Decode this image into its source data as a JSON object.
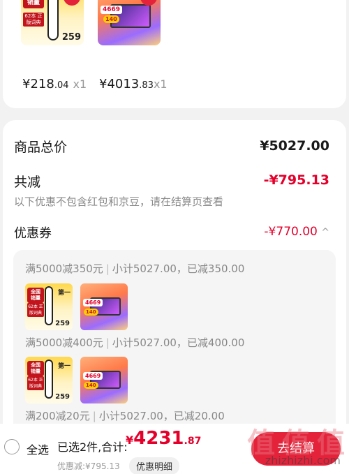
{
  "top_products": [
    {
      "name": "translation-pen",
      "price_int": "¥218",
      "price_dec": ".04",
      "qty": "x1",
      "badge_lines": [
        "全国",
        "销量"
      ],
      "badge2": "62本 正版词典",
      "promo": "第一",
      "tag_price": "259"
    },
    {
      "name": "laptop",
      "price_int": "¥4013",
      "price_dec": ".83",
      "qty": "x1",
      "badge_price": "4669",
      "badge_sub": "140"
    }
  ],
  "summary": {
    "goods_total_label": "商品总价",
    "goods_total_value": "¥5027.00",
    "total_reduce_label": "共减",
    "total_reduce_value": "-¥795.13",
    "reduce_note": "以下优惠不包含红包和京豆，请在结算页查看",
    "coupon_label": "优惠券",
    "coupon_value": "-¥770.00",
    "coupon_chevron": "^"
  },
  "coupon_rules": [
    {
      "rule": "满5000减350元",
      "detail": "小计5027.00，已减350.00"
    },
    {
      "rule": "满5000减400元",
      "detail": "小计5027.00，已减400.00"
    },
    {
      "rule": "满200减20元",
      "detail": "小计5027.00，已减20.00"
    }
  ],
  "bottom_bar": {
    "select_all": "全选",
    "selected_prefix": "已选2件,合计:",
    "total_yen": "¥",
    "total_int": "4231",
    "total_dec": ".87",
    "discount": "优惠减:¥795.13",
    "detail_button": "优惠明细",
    "checkout_button": "去结算"
  },
  "watermark": {
    "logo": "值 值 值",
    "url": "zhizhizhi.com"
  },
  "colors": {
    "accent": "#e4233b",
    "price_red": "#e4002b",
    "background": "#f2f2f2"
  }
}
